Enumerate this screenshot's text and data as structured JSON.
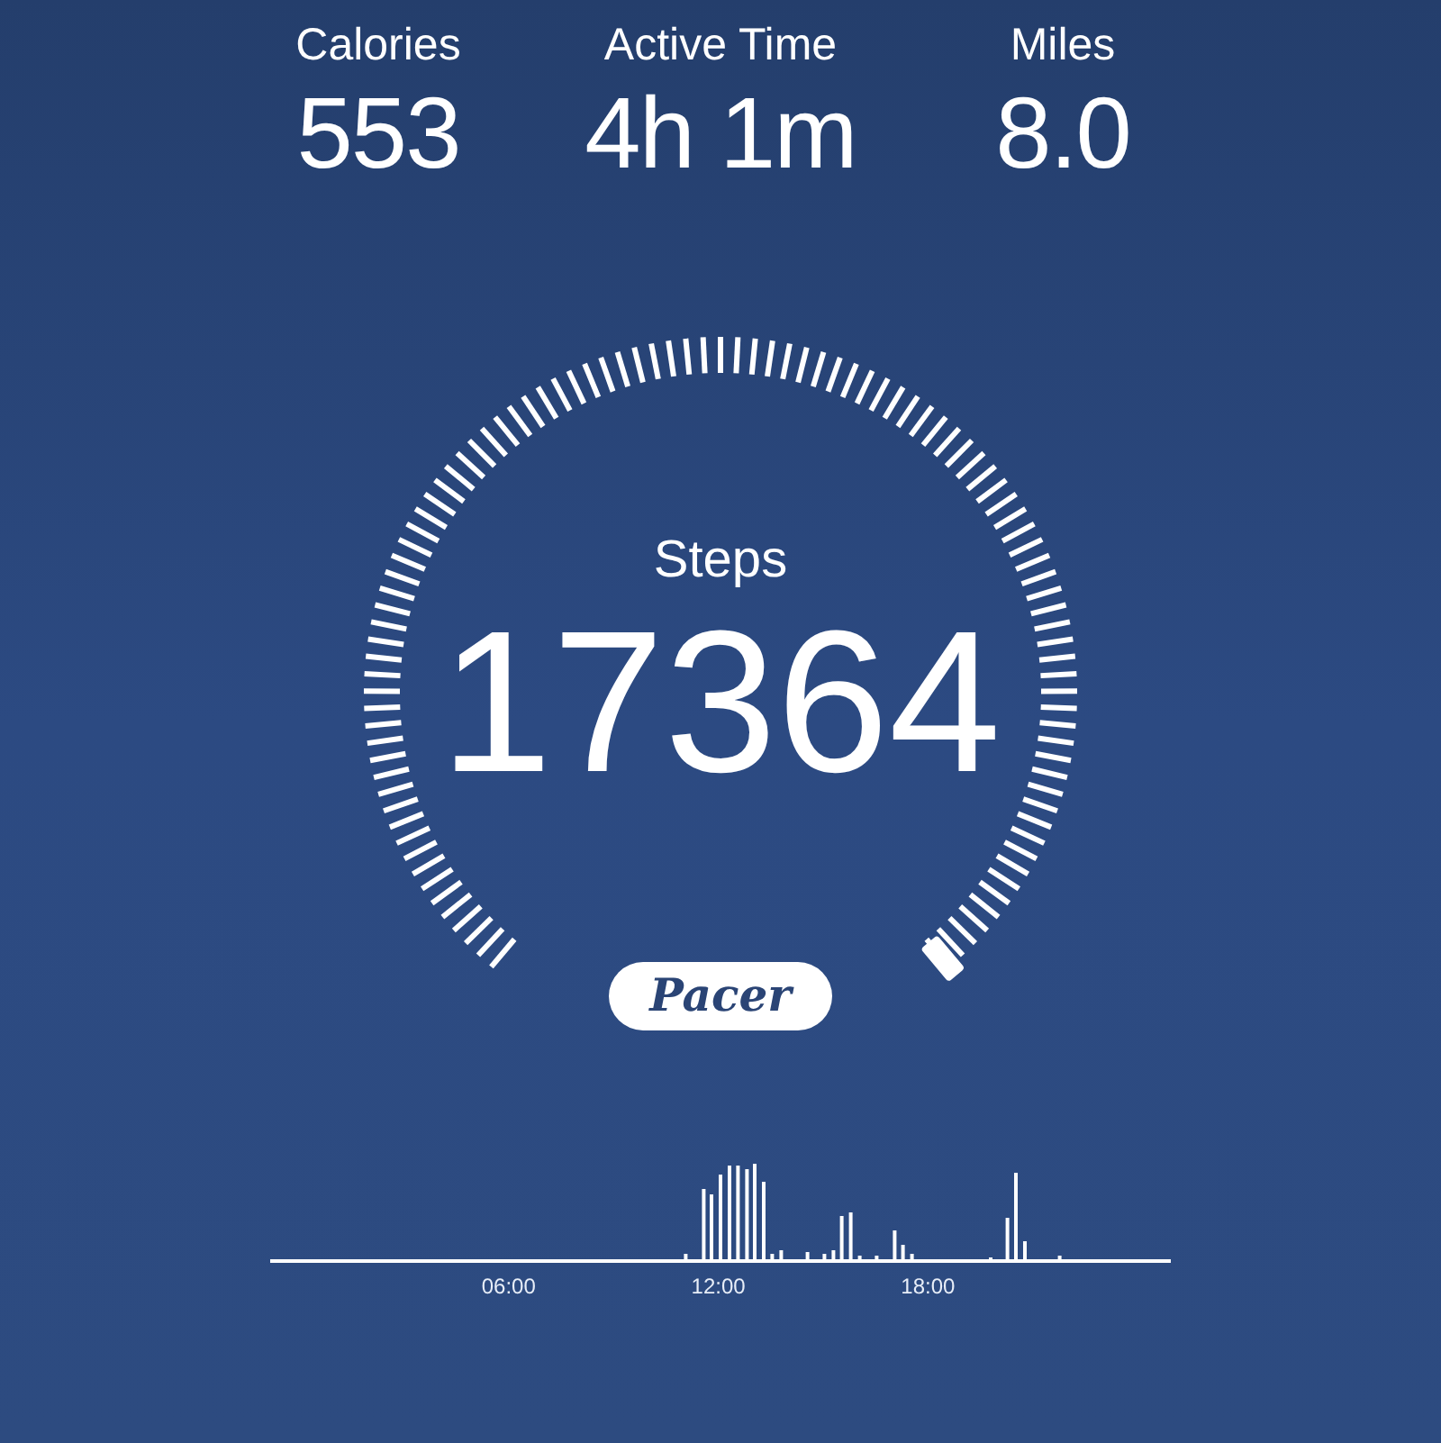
{
  "stats": [
    {
      "label": "Calories",
      "value": "553"
    },
    {
      "label": "Active Time",
      "value": "4h 1m"
    },
    {
      "label": "Miles",
      "value": "8.0"
    }
  ],
  "steps": {
    "label": "Steps",
    "value": "17364"
  },
  "badge": {
    "label": "Pacer"
  },
  "activity_chart": {
    "x_labels": [
      "06:00",
      "12:00",
      "18:00"
    ]
  }
}
